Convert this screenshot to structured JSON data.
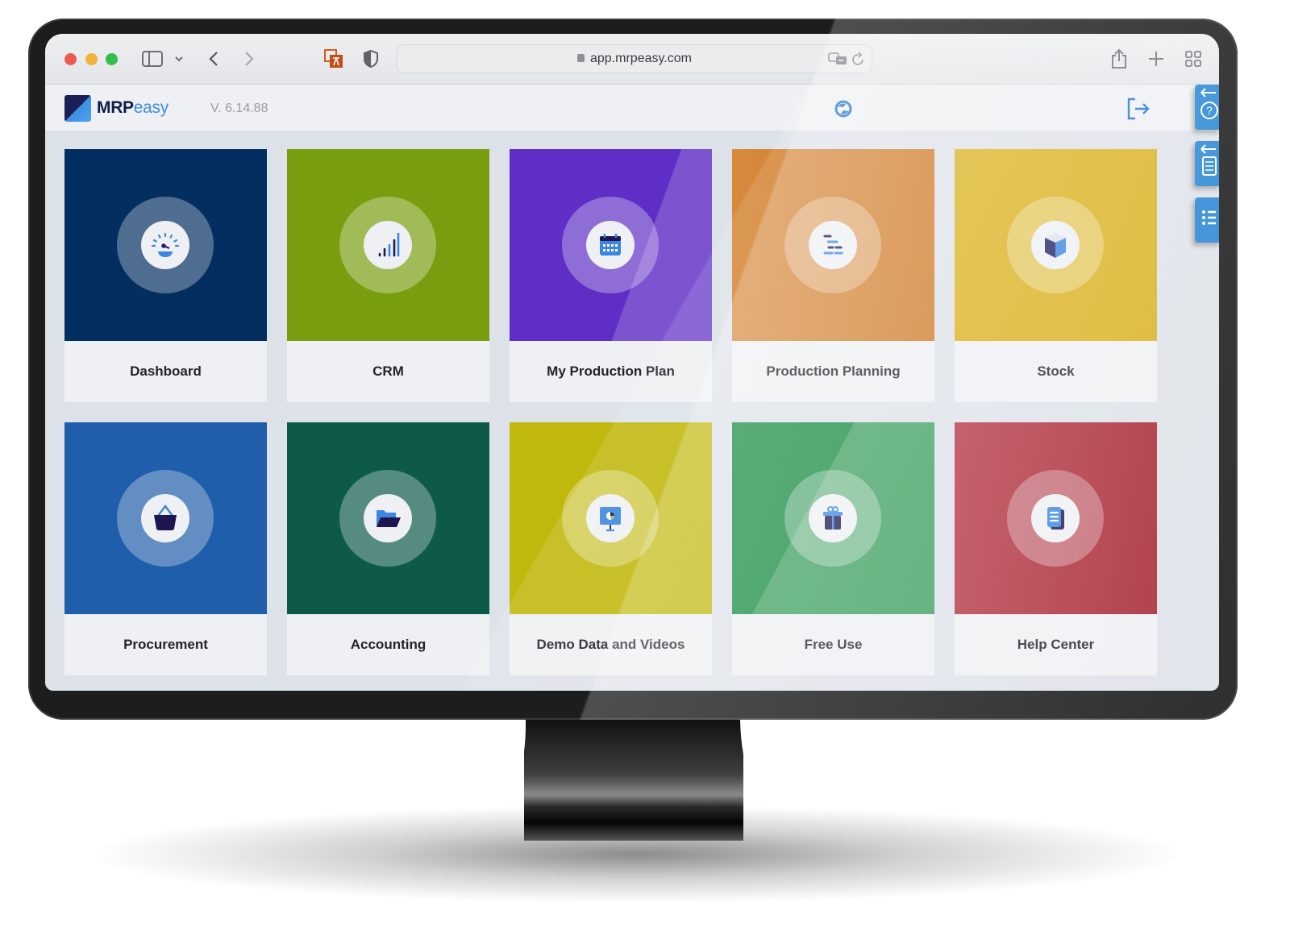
{
  "browser": {
    "url": "app.mrpeasy.com",
    "toolbar_icons": [
      "sidebar-toggle-icon",
      "chevron-down-icon",
      "back-icon",
      "forward-icon",
      "translate-extension-icon",
      "privacy-shield-icon",
      "share-icon",
      "new-tab-icon",
      "tab-overview-icon"
    ],
    "address_icons": [
      "lock-icon",
      "translate-icon",
      "reload-icon"
    ]
  },
  "app": {
    "logo_main": "MRP",
    "logo_accent": "easy",
    "version": "V. 6.14.88",
    "header_icons": [
      "sync-icon",
      "logout-icon"
    ],
    "side_tabs": [
      {
        "name": "help-side-tab",
        "icon": "question-icon"
      },
      {
        "name": "checklist-side-tab",
        "icon": "checklist-icon"
      },
      {
        "name": "list-side-tab",
        "icon": "list-icon"
      }
    ]
  },
  "tiles": [
    {
      "label": "Dashboard",
      "icon": "speedometer-icon",
      "color": "#032f60"
    },
    {
      "label": "CRM",
      "icon": "bar-chart-icon",
      "color": "#789e0f"
    },
    {
      "label": "My Production Plan",
      "icon": "calendar-icon",
      "color": "#5f2ec6"
    },
    {
      "label": "Production Planning",
      "icon": "gantt-icon",
      "color": "#d4812f"
    },
    {
      "label": "Stock",
      "icon": "box-icon",
      "color": "#d9b01b"
    },
    {
      "label": "Procurement",
      "icon": "basket-icon",
      "color": "#1f5eab"
    },
    {
      "label": "Accounting",
      "icon": "folder-icon",
      "color": "#0d5a4b"
    },
    {
      "label": "Demo Data and Videos",
      "icon": "presentation-icon",
      "color": "#c1b80d"
    },
    {
      "label": "Free Use",
      "icon": "gift-icon",
      "color": "#138a3e"
    },
    {
      "label": "Help Center",
      "icon": "document-icon",
      "color": "#ac2a38"
    }
  ]
}
